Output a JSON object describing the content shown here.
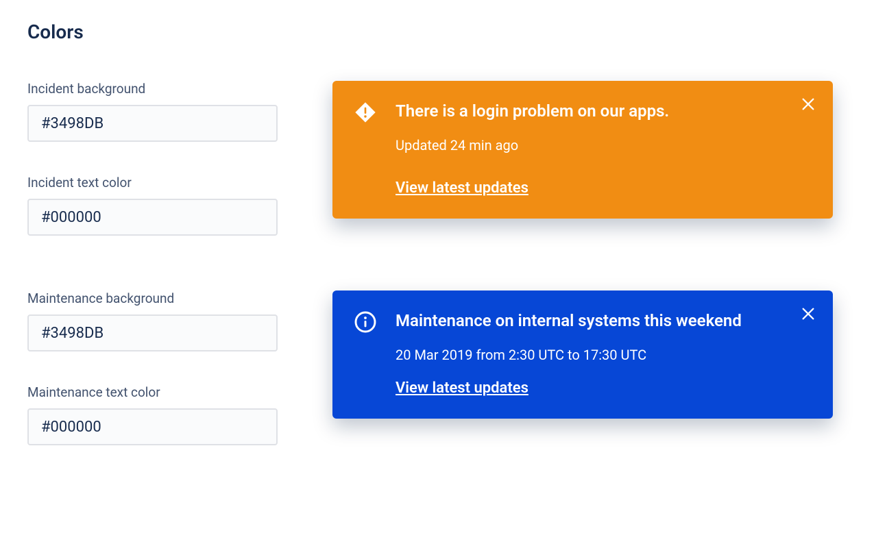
{
  "section_title": "Colors",
  "fields": {
    "incident_bg": {
      "label": "Incident background",
      "value": "#3498DB"
    },
    "incident_text": {
      "label": "Incident text color",
      "value": "#000000"
    },
    "maintenance_bg": {
      "label": "Maintenance background",
      "value": "#3498DB"
    },
    "maintenance_text": {
      "label": "Maintenance text color",
      "value": "#000000"
    }
  },
  "banners": {
    "incident": {
      "title": "There is a login problem on our apps.",
      "subtitle": "Updated 24 min ago",
      "link_text": "View latest updates"
    },
    "maintenance": {
      "title": "Maintenance on internal systems this weekend",
      "subtitle": "20 Mar 2019 from 2:30 UTC to 17:30 UTC",
      "link_text": "View latest updates"
    }
  },
  "colors": {
    "incident_banner_bg": "#F18D13",
    "maintenance_banner_bg": "#0747D6"
  }
}
